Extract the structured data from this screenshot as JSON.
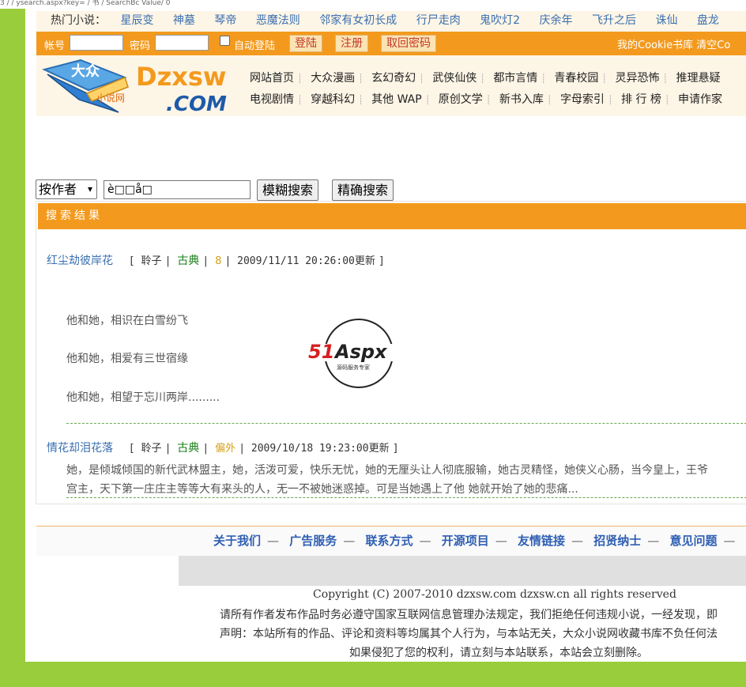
{
  "top_strip": "3 / / ysearch.aspx?key=  / 书 / SearchBc  Value/  0",
  "hot": {
    "label": "热门小说：",
    "links": [
      "星辰变",
      "神墓",
      "琴帝",
      "恶魔法则",
      "邻家有女初长成",
      "行尸走肉",
      "鬼吹灯2",
      "庆余年",
      "飞升之后",
      "诛仙",
      "盘龙"
    ]
  },
  "login": {
    "account_label": "帐号",
    "password_label": "密码",
    "auto_login_label": "自动登陆",
    "login_button": "登陆",
    "register_button": "注册",
    "retrieve_button": "取回密码",
    "right_links": "我的Cookie书库  清空Co"
  },
  "logo": {
    "brand_top": "Dzxsw",
    "brand_bottom": ".COM",
    "sub": "小说网",
    "big_chars": "大众"
  },
  "nav": {
    "row1": [
      "网站首页",
      "大众漫画",
      "玄幻奇幻",
      "武侠仙侠",
      "都市言情",
      "青春校园",
      "灵异恐怖",
      "推理悬疑"
    ],
    "row2": [
      "电视剧情",
      "穿越科幻",
      "其他 WAP",
      "原创文学",
      "新书入库",
      "字母索引",
      "排 行 榜",
      "申请作家"
    ]
  },
  "search": {
    "type_selected": "按作者",
    "keyword": "è□□å□",
    "fuzzy_button": "模糊搜索",
    "exact_button": "精确搜索"
  },
  "results": {
    "title": "搜索结果",
    "items": [
      {
        "title": "红尘劫彼岸花",
        "author": "聆子",
        "category": "古典",
        "count": "8",
        "updated": "2009/11/11 20:26:00更新",
        "desc": [
          "他和她，相识在白雪纷飞",
          "他和她，相爱有三世宿缘",
          "他和她，相望于忘川两岸........."
        ]
      },
      {
        "title": "情花却泪花落",
        "author": "聆子",
        "category": "古典",
        "count": "偏外",
        "updated": "2009/10/18 19:23:00更新",
        "desc": [
          "她，是倾城倾国的新代武林盟主，她，活泼可爱，快乐无忧，她的无厘头让人彻底服输，她古灵精怪，她侠义心肠，当今皇上，王爷",
          "宫主，天下第一庄庄主等等大有来头的人，无一不被她迷惑掉。可是当她遇上了他  她就开始了她的悲痛..."
        ]
      }
    ]
  },
  "watermark": {
    "brand_red": "51",
    "brand_rest": "Aspx",
    "sub": "源码服务专家"
  },
  "footer": {
    "nav": [
      "关于我们",
      "广告服务",
      "联系方式",
      "开源项目",
      "友情链接",
      "招贤纳士",
      "意见问题"
    ],
    "copyright": "Copyright (C) 2007-2010 dzxsw.com dzxsw.cn all rights reserved",
    "line2": "请所有作者发布作品时务必遵守国家互联网信息管理办法规定，我们拒绝任何违规小说，一经发现，即",
    "line3": "声明：本站所有的作品、评论和资料等均属其个人行为，与本站无关，大众小说网收藏书库不负任何法",
    "line4": "如果侵犯了您的权利，请立刻与本站联系，本站会立刻删除。"
  },
  "colors": {
    "accent_orange": "#f39a1e",
    "page_green": "#9acd3c",
    "link_blue": "#3a6fb0"
  }
}
